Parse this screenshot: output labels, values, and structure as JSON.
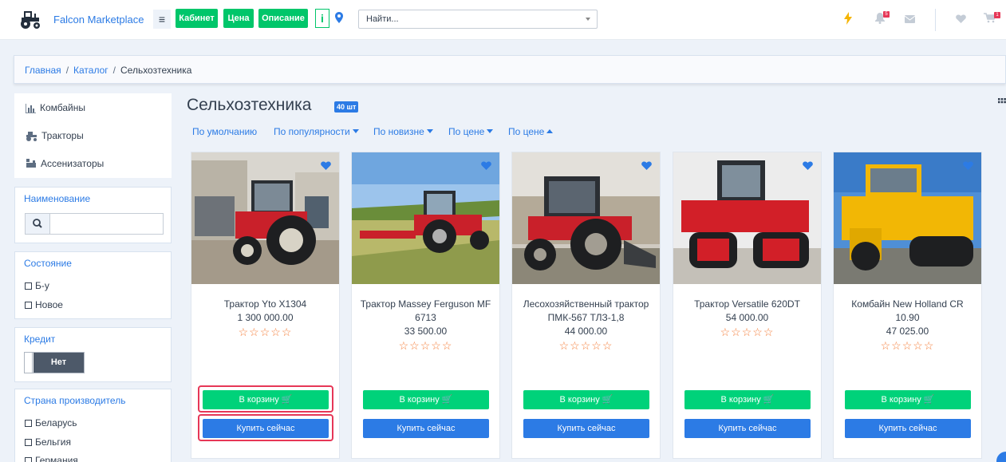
{
  "header": {
    "brand": "Falcon Marketplace",
    "buttons": [
      "Кабинет",
      "Цена",
      "Описание"
    ],
    "info_label": "i",
    "search_placeholder": "Найти...",
    "notification_count": "5",
    "cart_count": "1",
    "accent_color": "#00c66a"
  },
  "breadcrumb": {
    "home": "Главная",
    "catalog": "Каталог",
    "current": "Сельхозтехника",
    "separator": "/"
  },
  "sidebar": {
    "categories": [
      {
        "label": "Комбайны",
        "icon": "chart-icon"
      },
      {
        "label": "Тракторы",
        "icon": "tractor-icon"
      },
      {
        "label": "Ассенизаторы",
        "icon": "tank-icon"
      }
    ],
    "name_filter": {
      "title": "Наименование"
    },
    "condition": {
      "title": "Состояние",
      "options": [
        "Б-у",
        "Новое"
      ]
    },
    "credit": {
      "title": "Кредит",
      "value": "Нет"
    },
    "country": {
      "title": "Страна производитель",
      "options": [
        "Беларусь",
        "Бельгия",
        "Германия"
      ]
    }
  },
  "main": {
    "title": "Сельхозтехника",
    "count_badge": "40 шт",
    "sort_options": [
      {
        "label": "По умолчанию",
        "arrow": ""
      },
      {
        "label": "По популярности",
        "arrow": "down"
      },
      {
        "label": "По новизне",
        "arrow": "down"
      },
      {
        "label": "По цене",
        "arrow": "down"
      },
      {
        "label": "По цене",
        "arrow": "up"
      }
    ],
    "products": [
      {
        "name": "Трактор Yto X1304",
        "price": "1 300 000.00",
        "rating": 0
      },
      {
        "name": "Трактор Massey Ferguson MF 6713",
        "price": "33 500.00",
        "rating": 0
      },
      {
        "name": "Лесохозяйственный трактор ПМК-567 ТЛЗ-1,8",
        "price": "44 000.00",
        "rating": 0
      },
      {
        "name": "Трактор Versatile 620DT",
        "price": "54 000.00",
        "rating": 0
      },
      {
        "name": "Комбайн New Holland CR 10.90",
        "price": "47 025.00",
        "rating": 0
      }
    ],
    "cart_label": "В корзину",
    "buy_label": "Купить сейчас",
    "stars": "☆☆☆☆☆"
  }
}
